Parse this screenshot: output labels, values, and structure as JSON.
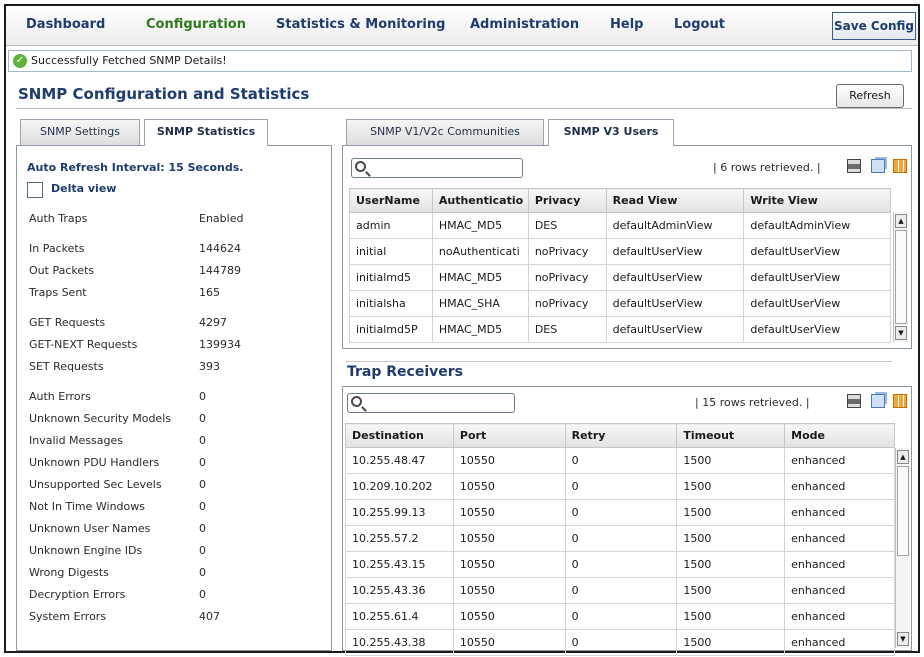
{
  "nav": {
    "items": [
      "Dashboard",
      "Configuration",
      "Statistics & Monitoring",
      "Administration",
      "Help",
      "Logout"
    ],
    "active": "Configuration",
    "save_label": "Save Config"
  },
  "status": {
    "message": "Successfully Fetched SNMP Details!"
  },
  "page": {
    "title": "SNMP Configuration and Statistics",
    "refresh_label": "Refresh"
  },
  "left_tabs": [
    "SNMP Settings",
    "SNMP Statistics"
  ],
  "left_tabs_selected": "SNMP Statistics",
  "stats": {
    "auto_refresh": "Auto Refresh Interval: 15 Seconds.",
    "delta_label": "Delta view",
    "items": [
      {
        "label": "Auth Traps",
        "value": "Enabled"
      },
      {
        "label": "In Packets",
        "value": "144624"
      },
      {
        "label": "Out Packets",
        "value": "144789"
      },
      {
        "label": "Traps Sent",
        "value": "165"
      },
      {
        "label": "GET Requests",
        "value": "4297"
      },
      {
        "label": "GET-NEXT Requests",
        "value": "139934"
      },
      {
        "label": "SET Requests",
        "value": "393"
      },
      {
        "label": "Auth Errors",
        "value": "0"
      },
      {
        "label": "Unknown Security Models",
        "value": "0"
      },
      {
        "label": "Invalid Messages",
        "value": "0"
      },
      {
        "label": "Unknown PDU Handlers",
        "value": "0"
      },
      {
        "label": "Unsupported Sec Levels",
        "value": "0"
      },
      {
        "label": "Not In Time Windows",
        "value": "0"
      },
      {
        "label": "Unknown User Names",
        "value": "0"
      },
      {
        "label": "Unknown Engine IDs",
        "value": "0"
      },
      {
        "label": "Wrong Digests",
        "value": "0"
      },
      {
        "label": "Decryption Errors",
        "value": "0"
      },
      {
        "label": "System Errors",
        "value": "407"
      }
    ]
  },
  "right_tabs": [
    "SNMP V1/V2c Communities",
    "SNMP V3 Users"
  ],
  "right_tabs_selected": "SNMP V3 Users",
  "users": {
    "rows_text": "| 6 rows retrieved. |",
    "columns": [
      "UserName",
      "Authenticatio",
      "Privacy",
      "Read View",
      "Write View"
    ],
    "rows": [
      [
        "admin",
        "HMAC_MD5",
        "DES",
        "defaultAdminView",
        "defaultAdminView"
      ],
      [
        "initial",
        "noAuthenticati",
        "noPrivacy",
        "defaultUserView",
        "defaultUserView"
      ],
      [
        "initialmd5",
        "HMAC_MD5",
        "noPrivacy",
        "defaultUserView",
        "defaultUserView"
      ],
      [
        "initialsha",
        "HMAC_SHA",
        "noPrivacy",
        "defaultUserView",
        "defaultUserView"
      ],
      [
        "initialmd5P",
        "HMAC_MD5",
        "DES",
        "defaultUserView",
        "defaultUserView"
      ]
    ]
  },
  "trap": {
    "title": "Trap Receivers",
    "rows_text": "| 15 rows retrieved. |",
    "columns": [
      "Destination",
      "Port",
      "Retry",
      "Timeout",
      "Mode"
    ],
    "rows": [
      [
        "10.255.48.47",
        "10550",
        "0",
        "1500",
        "enhanced"
      ],
      [
        "10.209.10.202",
        "10550",
        "0",
        "1500",
        "enhanced"
      ],
      [
        "10.255.99.13",
        "10550",
        "0",
        "1500",
        "enhanced"
      ],
      [
        "10.255.57.2",
        "10550",
        "0",
        "1500",
        "enhanced"
      ],
      [
        "10.255.43.15",
        "10550",
        "0",
        "1500",
        "enhanced"
      ],
      [
        "10.255.43.36",
        "10550",
        "0",
        "1500",
        "enhanced"
      ],
      [
        "10.255.61.4",
        "10550",
        "0",
        "1500",
        "enhanced"
      ],
      [
        "10.255.43.38",
        "10550",
        "0",
        "1500",
        "enhanced"
      ]
    ]
  },
  "icons": [
    "check-circle-icon",
    "search-icon",
    "print-icon",
    "copy-icon",
    "columns-icon",
    "scroll-up-icon",
    "scroll-down-icon"
  ],
  "colors": {
    "nav_text": "#1f3c6e",
    "nav_active": "#2f7a1f",
    "ok": "#5fb33c"
  }
}
